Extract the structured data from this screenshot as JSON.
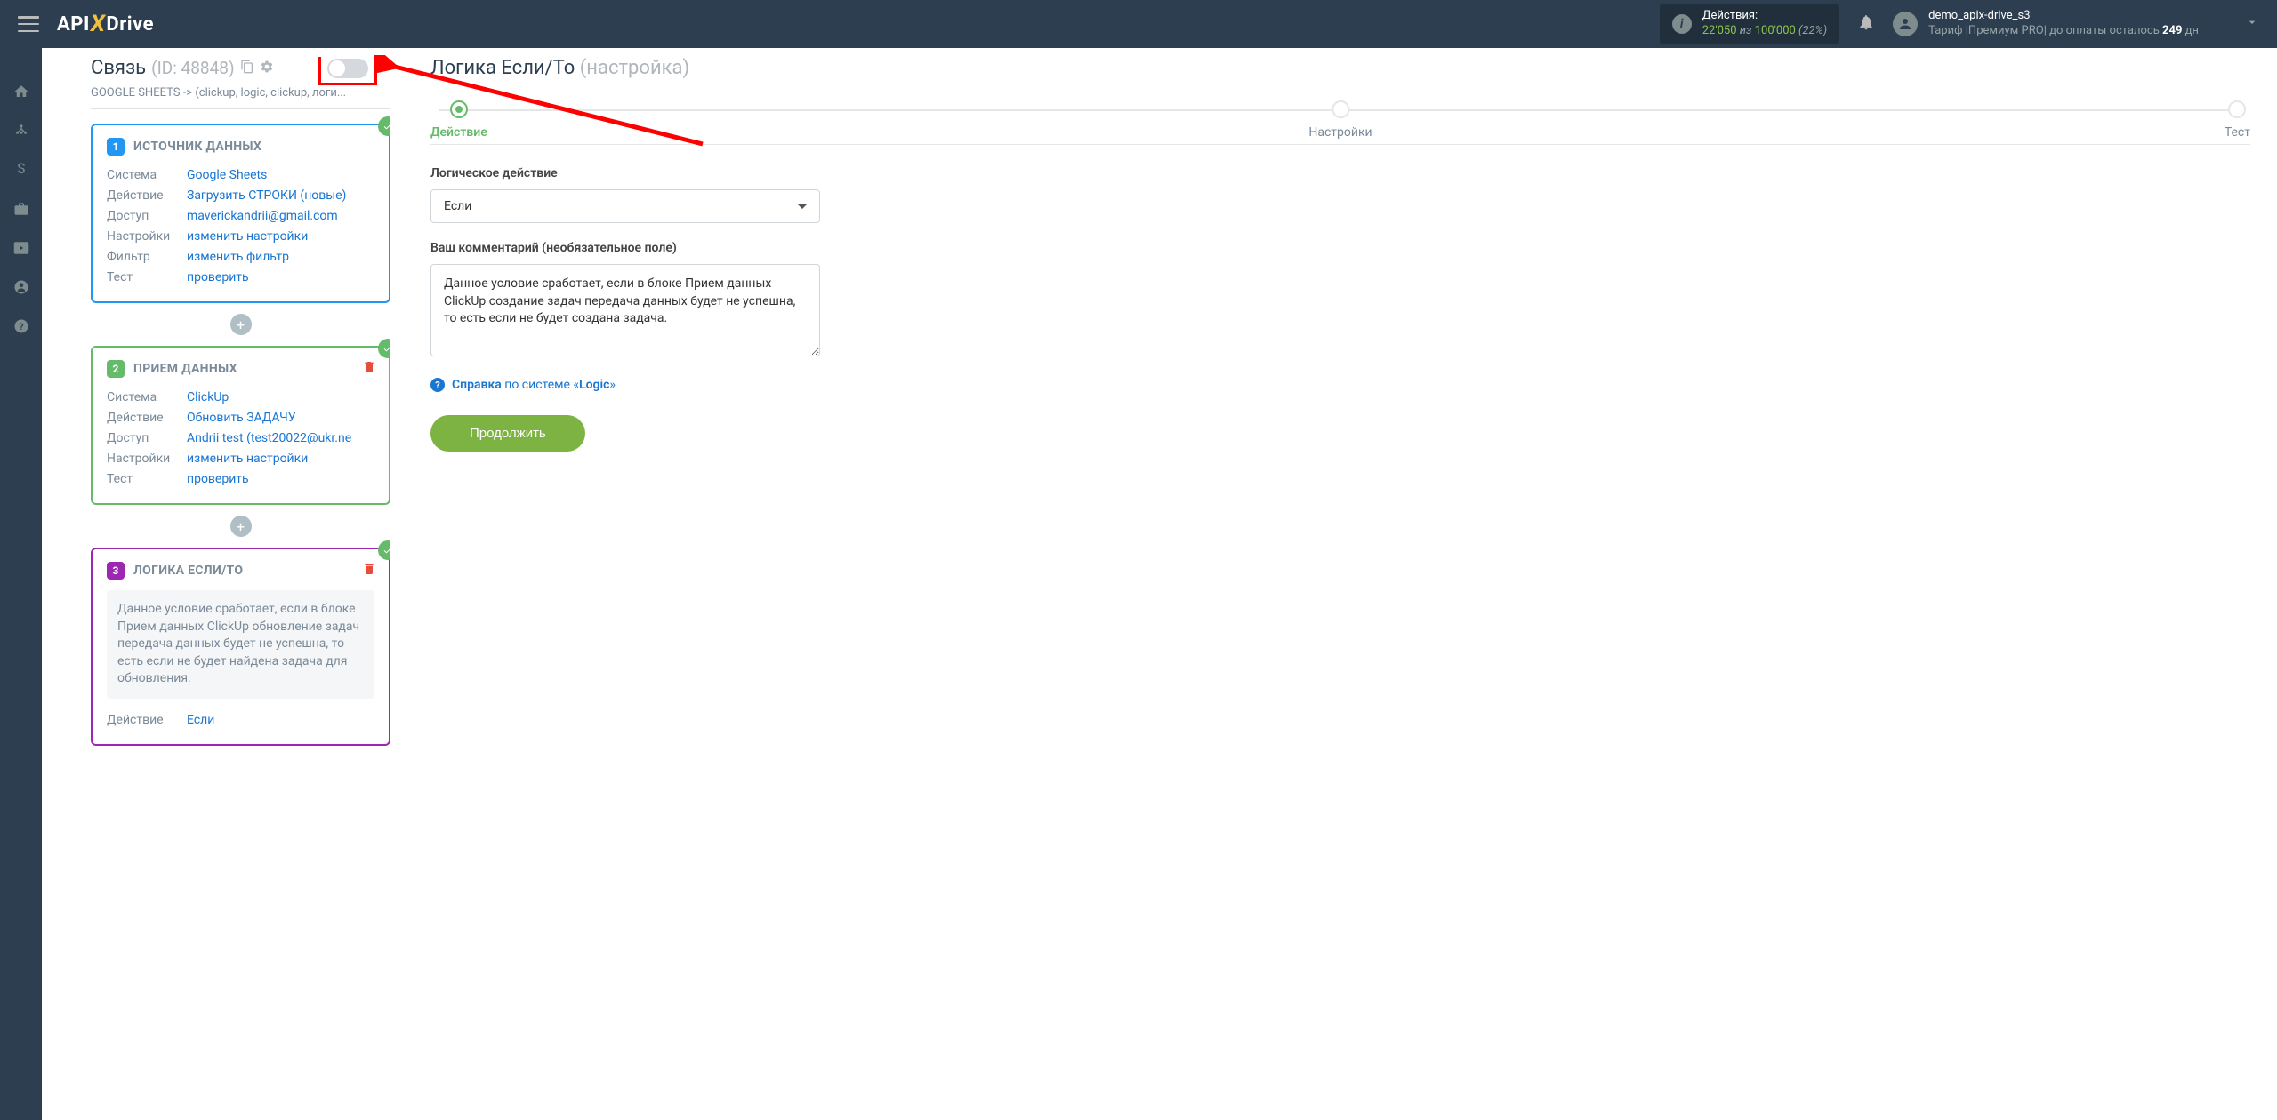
{
  "topbar": {
    "logo_a": "API",
    "logo_b": "Drive",
    "actions_label": "Действия:",
    "actions_used": "22'050",
    "actions_iz": "из",
    "actions_total": "100'000",
    "actions_pct": "(22%)",
    "username": "demo_apix-drive_s3",
    "tariff_prefix": "Тариф |Премиум PRO| до оплаты осталось",
    "tariff_days": "249",
    "tariff_suffix": "дн"
  },
  "left": {
    "title": "Связь",
    "id_label": "(ID: 48848)",
    "breadcrumb": "GOOGLE SHEETS -> (clickup, logic, clickup, логи...",
    "card1": {
      "title": "ИСТОЧНИК ДАННЫХ",
      "rows": {
        "system_l": "Система",
        "system_v": "Google Sheets",
        "action_l": "Действие",
        "action_v": "Загрузить СТРОКИ (новые)",
        "access_l": "Доступ",
        "access_v": "maverickandrii@gmail.com",
        "settings_l": "Настройки",
        "settings_v": "изменить настройки",
        "filter_l": "Фильтр",
        "filter_v": "изменить фильтр",
        "test_l": "Тест",
        "test_v": "проверить"
      }
    },
    "card2": {
      "title": "ПРИЕМ ДАННЫХ",
      "rows": {
        "system_l": "Система",
        "system_v": "ClickUp",
        "action_l": "Действие",
        "action_v": "Обновить ЗАДАЧУ",
        "access_l": "Доступ",
        "access_v": "Andrii test (test20022@ukr.ne",
        "settings_l": "Настройки",
        "settings_v": "изменить настройки",
        "test_l": "Тест",
        "test_v": "проверить"
      }
    },
    "card3": {
      "title": "ЛОГИКА ЕСЛИ/ТО",
      "desc": "Данное условие сработает, если в блоке Прием данных ClickUp обновление задач передача данных будет не успешна, то есть если не будет найдена задача для обновления.",
      "rows": {
        "action_l": "Действие",
        "action_v": "Если"
      }
    }
  },
  "right": {
    "title": "Логика Если/То",
    "subtitle": "(настройка)",
    "steps": {
      "s1": "Действие",
      "s2": "Настройки",
      "s3": "Тест"
    },
    "form": {
      "logic_label": "Логическое действие",
      "logic_value": "Если",
      "comment_label": "Ваш комментарий (необязательное поле)",
      "comment_value": "Данное условие сработает, если в блоке Прием данных ClickUp создание задач передача данных будет не успешна, то есть если не будет создана задача."
    },
    "help": {
      "bold": "Справка",
      "mid": "по системе «",
      "sys": "Logic",
      "end": "»"
    },
    "continue": "Продолжить"
  }
}
